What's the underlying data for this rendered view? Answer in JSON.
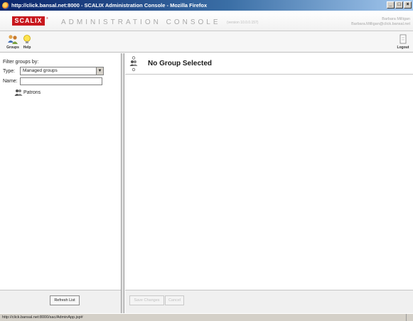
{
  "window": {
    "title": "http://click.bansal.net:8000 - SCALIX Administration Console - Mozilla Firefox",
    "controls": [
      "_",
      "□",
      "×"
    ]
  },
  "banner": {
    "logo": "SCALIX",
    "logo_tm": "®",
    "title": "ADMINISTRATION CONSOLE",
    "version": "(version 10.0.0.157)",
    "user_name": "Barbara Milligan",
    "user_email": "Barbara.Milligan@click.bansal.net"
  },
  "toolbar": {
    "groups_label": "Groups",
    "help_label": "Help",
    "logout_label": "Logout"
  },
  "filter": {
    "title": "Filter groups by:",
    "type_label": "Type:",
    "type_value": "Managed groups",
    "name_label": "Name:",
    "name_value": ""
  },
  "tree": {
    "items": [
      {
        "label": "Patrons",
        "icon": "group-icon"
      }
    ]
  },
  "left_footer": {
    "refresh_label": "Refresh List"
  },
  "details": {
    "title": "No Group Selected"
  },
  "right_footer": {
    "save_label": "Save Changes",
    "cancel_label": "Cancel"
  },
  "status": {
    "url": "http://click.bansal.net:8000/sac/AdminApp.jsp#"
  },
  "colors": {
    "logo_red": "#c8181e",
    "titlebar_blue": "#0a246a"
  }
}
